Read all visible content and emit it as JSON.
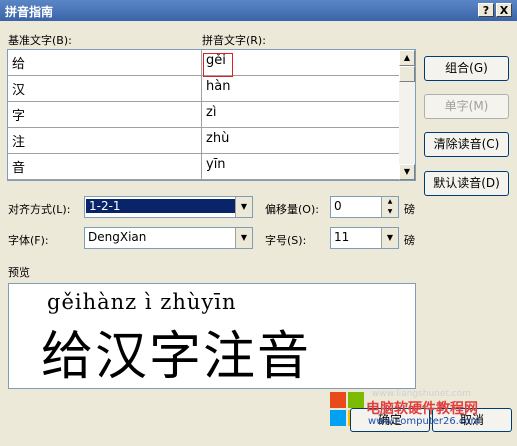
{
  "window": {
    "title": "拼音指南",
    "help_btn": "?",
    "close_btn": "X"
  },
  "labels": {
    "base_text": "基准文字(B):",
    "pinyin_text": "拼音文字(R):",
    "align": "对齐方式(L):",
    "offset": "偏移量(O):",
    "font": "字体(F):",
    "size": "字号(S):",
    "preview": "预览",
    "pound1": "磅",
    "pound2": "磅"
  },
  "rows": [
    {
      "base": "给",
      "pinyin": "gěi"
    },
    {
      "base": "汉",
      "pinyin": "hàn"
    },
    {
      "base": "字",
      "pinyin": "zì"
    },
    {
      "base": "注",
      "pinyin": "zhù"
    },
    {
      "base": "音",
      "pinyin": "yīn"
    }
  ],
  "buttons": {
    "combine": "组合(G)",
    "single": "单字(M)",
    "clear": "清除读音(C)",
    "default": "默认读音(D)",
    "ok": "确定",
    "cancel": "取消"
  },
  "fields": {
    "align_value": "1-2-1",
    "offset_value": "0",
    "font_value": "DengXian",
    "size_value": "11"
  },
  "preview": {
    "pinyin": "gěihànz ì zhùyīn",
    "hanzi": "给汉字注音"
  },
  "watermark": {
    "url": "www.liangshunet.com",
    "brand": "电脑软硬件教程网",
    "site": "www.computer26.com"
  }
}
